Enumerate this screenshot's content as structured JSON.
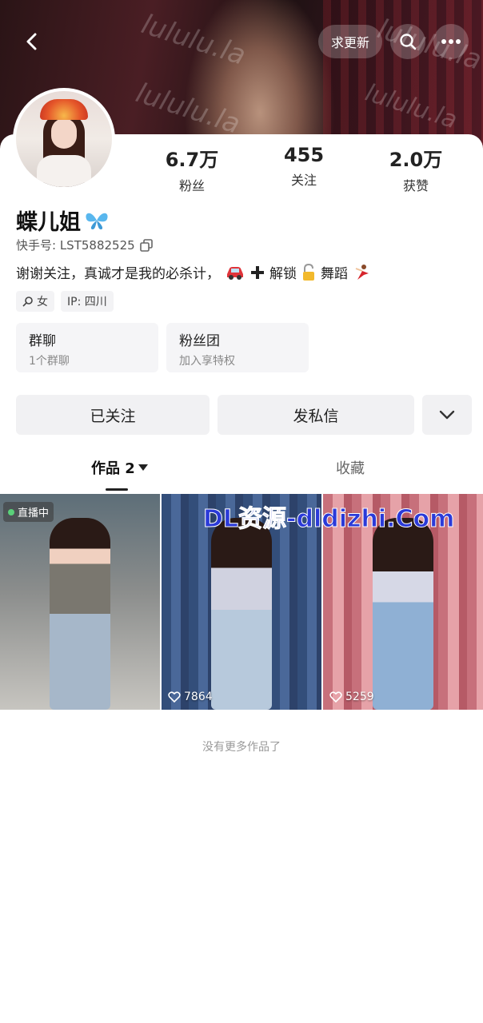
{
  "header": {
    "update_label": "求更新",
    "watermark": "lululu.la"
  },
  "profile": {
    "name": "蝶儿姐",
    "kuaishou_id": "快手号: LST5882525",
    "bio": "谢谢关注，真诚才是我的必杀计，",
    "bio_unlock": "解锁",
    "bio_dance": "舞蹈",
    "gender": "女",
    "ip": "IP: 四川"
  },
  "stats": [
    {
      "value": "6.7万",
      "label": "粉丝"
    },
    {
      "value": "455",
      "label": "关注"
    },
    {
      "value": "2.0万",
      "label": "获赞"
    }
  ],
  "groups": [
    {
      "title": "群聊",
      "subtitle": "1个群聊"
    },
    {
      "title": "粉丝团",
      "subtitle": "加入享特权"
    }
  ],
  "actions": {
    "follow_label": "已关注",
    "message_label": "发私信"
  },
  "tabs": {
    "works_label": "作品 2",
    "favorites_label": "收藏"
  },
  "grid": {
    "live_label": "直播中",
    "likes": [
      "7864",
      "5259"
    ],
    "overlay": "DL资源-dldizhi.Com"
  },
  "footer": "没有更多作品了",
  "colors": {
    "accent_overlay": "#2b3ad8",
    "live_dot": "#5ad17a"
  }
}
